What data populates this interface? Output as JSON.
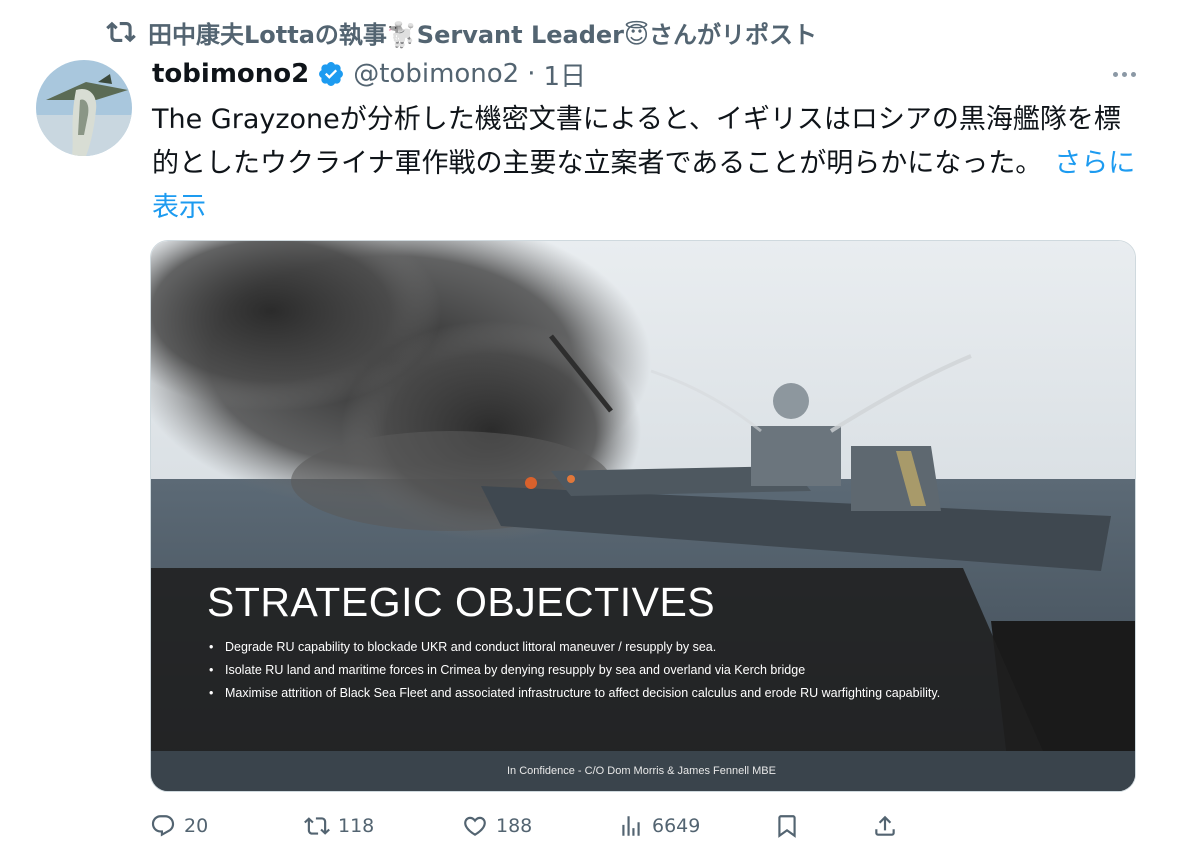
{
  "repost": {
    "icon": "repost-icon",
    "text": "田中康夫Lottaの執事🐩Servant Leader😇さんがリポスト"
  },
  "author": {
    "display_name": "tobimono2",
    "verified_icon": "verified-badge-icon",
    "handle": "@tobimono2",
    "separator": "·",
    "time": "1日"
  },
  "tweet": {
    "text": "The Grayzoneが分析した機密文書によると、イギリスはロシアの黒海艦隊を標的としたウクライナ軍作戦の主要な立案者であることが明らかになった。",
    "show_more": "さらに表示"
  },
  "media": {
    "slide_title": "STRATEGIC OBJECTIVES",
    "bullets": [
      "Degrade RU capability to blockade UKR and conduct littoral maneuver / resupply by sea.",
      "Isolate RU land and maritime forces in Crimea by denying resupply by sea and overland via Kerch bridge",
      "Maximise attrition of Black Sea Fleet and associated infrastructure to affect decision calculus and erode RU warfighting capability."
    ],
    "footer": "In Confidence - C/O Dom Morris & James Fennell MBE"
  },
  "actions": {
    "replies": "20",
    "reposts": "118",
    "likes": "188",
    "views": "6649"
  },
  "colors": {
    "link": "#1d9bf0",
    "muted": "#536471",
    "text": "#0f1419",
    "verified": "#1d9bf0"
  }
}
